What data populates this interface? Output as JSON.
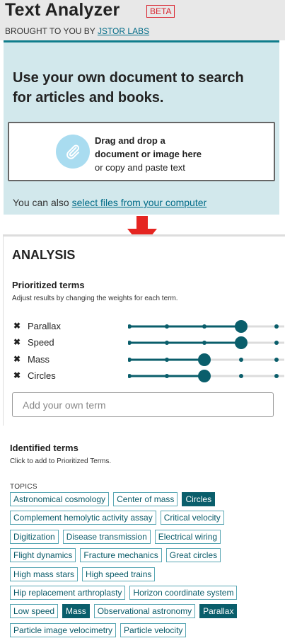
{
  "header": {
    "title": "Text Analyzer",
    "badge": "BETA",
    "byline_prefix": "BROUGHT TO YOU BY ",
    "byline_link": "JSTOR LABS"
  },
  "upload": {
    "heading": "Use your own document to search for articles and books.",
    "drop_line1": "Drag and drop a",
    "drop_line2": "document or image here",
    "drop_line3": "or copy and paste text",
    "also_prefix": "You can also ",
    "also_link": "select files from your computer"
  },
  "analysis": {
    "title": "ANALYSIS",
    "prioritized_title": "Prioritized terms",
    "prioritized_sub": "Adjust results by changing the weights for each term.",
    "terms": [
      {
        "label": "Parallax",
        "weight": 3
      },
      {
        "label": "Speed",
        "weight": 3
      },
      {
        "label": "Mass",
        "weight": 2
      },
      {
        "label": "Circles",
        "weight": 2
      }
    ],
    "remove_glyph": "✖",
    "add_placeholder": "Add your own term"
  },
  "identified": {
    "title": "Identified terms",
    "sub": "Click to add to Prioritized Terms.",
    "topics_label": "TOPICS",
    "topic_rows": [
      [
        {
          "label": "Astronomical cosmology",
          "selected": false
        },
        {
          "label": "Center of mass",
          "selected": false
        },
        {
          "label": "Circles",
          "selected": true
        }
      ],
      [
        {
          "label": "Complement hemolytic activity assay",
          "selected": false
        },
        {
          "label": "Critical velocity",
          "selected": false
        }
      ],
      [
        {
          "label": "Digitization",
          "selected": false
        },
        {
          "label": "Disease transmission",
          "selected": false
        },
        {
          "label": "Electrical wiring",
          "selected": false
        }
      ],
      [
        {
          "label": "Flight dynamics",
          "selected": false
        },
        {
          "label": "Fracture mechanics",
          "selected": false
        },
        {
          "label": "Great circles",
          "selected": false
        }
      ],
      [
        {
          "label": "High mass stars",
          "selected": false
        },
        {
          "label": "High speed trains",
          "selected": false
        }
      ],
      [
        {
          "label": "Hip replacement arthroplasty",
          "selected": false
        },
        {
          "label": "Horizon coordinate system",
          "selected": false
        }
      ],
      [
        {
          "label": "Low speed",
          "selected": false
        },
        {
          "label": "Mass",
          "selected": true
        },
        {
          "label": "Observational astronomy",
          "selected": false
        },
        {
          "label": "Parallax",
          "selected": true
        }
      ],
      [
        {
          "label": "Particle image velocimetry",
          "selected": false
        },
        {
          "label": "Particle velocity",
          "selected": false
        }
      ]
    ]
  },
  "colors": {
    "accent": "#0a5e6b",
    "brand_red": "#d9232e",
    "panel_bg": "#d2e8ec"
  }
}
